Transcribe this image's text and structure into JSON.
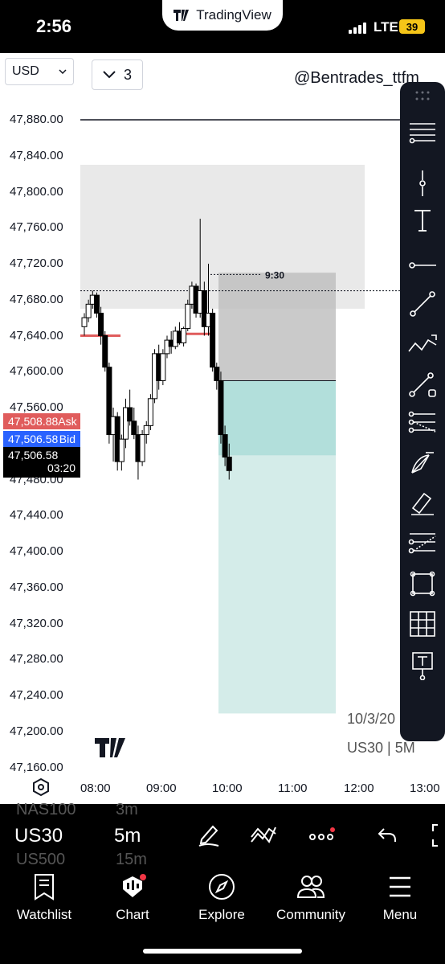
{
  "status_bar": {
    "time": "2:56",
    "app_name": "TradingView",
    "network": "LTE",
    "battery": "39"
  },
  "chart": {
    "currency_select": "USD",
    "interval_multiplier": "3",
    "watermark_handle": "@Bentrades_ttfm",
    "price_labels": [
      "47,880.00",
      "47,840.00",
      "47,800.00",
      "47,760.00",
      "47,720.00",
      "47,680.00",
      "47,640.00",
      "47,600.00",
      "47,560.00",
      "47,480.00",
      "47,440.00",
      "47,400.00",
      "47,360.00",
      "47,320.00",
      "47,280.00",
      "47,240.00",
      "47,200.00",
      "47,160.00"
    ],
    "time_labels": [
      "08:00",
      "09:00",
      "10:00",
      "11:00",
      "12:00",
      "13:00"
    ],
    "ask": {
      "price": "47,508.88",
      "label": "Ask"
    },
    "bid": {
      "price": "47,506.58",
      "label": "Bid"
    },
    "last": {
      "price": "47,506.58",
      "countdown": "03:20"
    },
    "annotation_time": "9:30",
    "date_label": "10/3/20",
    "symbol_label": "US30 | 5M",
    "colors": {
      "ask": "#e05c5c",
      "bid": "#2962ff",
      "profit_zone": "#b2dfdb",
      "loss_zone": "#bdbdbd",
      "supply_zone": "#e9e9e9"
    }
  },
  "chart_data": {
    "type": "candlestick",
    "symbol": "US30",
    "interval": "5M",
    "ylim": [
      47150,
      47900
    ],
    "x_ticks": [
      "08:00",
      "09:00",
      "10:00",
      "11:00",
      "12:00",
      "13:00"
    ],
    "horizontal_line": 47880,
    "supply_zone": [
      47670,
      47830
    ],
    "position": {
      "entry": 47590,
      "stop": 47710,
      "target": 47220,
      "partial": 47507
    },
    "candles": [
      {
        "o": 47650,
        "h": 47665,
        "l": 47640,
        "c": 47660
      },
      {
        "o": 47660,
        "h": 47680,
        "l": 47655,
        "c": 47675
      },
      {
        "o": 47675,
        "h": 47690,
        "l": 47670,
        "c": 47685
      },
      {
        "o": 47685,
        "h": 47688,
        "l": 47660,
        "c": 47665
      },
      {
        "o": 47665,
        "h": 47672,
        "l": 47630,
        "c": 47640
      },
      {
        "o": 47640,
        "h": 47645,
        "l": 47600,
        "c": 47605
      },
      {
        "o": 47605,
        "h": 47610,
        "l": 47520,
        "c": 47530
      },
      {
        "o": 47530,
        "h": 47560,
        "l": 47500,
        "c": 47550
      },
      {
        "o": 47550,
        "h": 47555,
        "l": 47490,
        "c": 47500
      },
      {
        "o": 47500,
        "h": 47530,
        "l": 47490,
        "c": 47525
      },
      {
        "o": 47525,
        "h": 47570,
        "l": 47515,
        "c": 47560
      },
      {
        "o": 47560,
        "h": 47580,
        "l": 47540,
        "c": 47545
      },
      {
        "o": 47545,
        "h": 47560,
        "l": 47525,
        "c": 47530
      },
      {
        "o": 47530,
        "h": 47540,
        "l": 47480,
        "c": 47500
      },
      {
        "o": 47500,
        "h": 47535,
        "l": 47495,
        "c": 47530
      },
      {
        "o": 47530,
        "h": 47545,
        "l": 47520,
        "c": 47540
      },
      {
        "o": 47540,
        "h": 47575,
        "l": 47535,
        "c": 47570
      },
      {
        "o": 47570,
        "h": 47625,
        "l": 47565,
        "c": 47620
      },
      {
        "o": 47620,
        "h": 47630,
        "l": 47580,
        "c": 47590
      },
      {
        "o": 47590,
        "h": 47625,
        "l": 47585,
        "c": 47620
      },
      {
        "o": 47620,
        "h": 47640,
        "l": 47615,
        "c": 47635
      },
      {
        "o": 47635,
        "h": 47645,
        "l": 47620,
        "c": 47628
      },
      {
        "o": 47628,
        "h": 47650,
        "l": 47625,
        "c": 47645
      },
      {
        "o": 47645,
        "h": 47655,
        "l": 47630,
        "c": 47632
      },
      {
        "o": 47632,
        "h": 47650,
        "l": 47628,
        "c": 47648
      },
      {
        "o": 47648,
        "h": 47680,
        "l": 47645,
        "c": 47675
      },
      {
        "o": 47675,
        "h": 47700,
        "l": 47670,
        "c": 47695
      },
      {
        "o": 47695,
        "h": 47698,
        "l": 47660,
        "c": 47665
      },
      {
        "o": 47665,
        "h": 47770,
        "l": 47660,
        "c": 47690
      },
      {
        "o": 47690,
        "h": 47700,
        "l": 47640,
        "c": 47650
      },
      {
        "o": 47650,
        "h": 47720,
        "l": 47640,
        "c": 47665
      },
      {
        "o": 47665,
        "h": 47670,
        "l": 47600,
        "c": 47605
      },
      {
        "o": 47605,
        "h": 47610,
        "l": 47580,
        "c": 47590
      },
      {
        "o": 47590,
        "h": 47600,
        "l": 47520,
        "c": 47530
      },
      {
        "o": 47530,
        "h": 47540,
        "l": 47495,
        "c": 47505
      },
      {
        "o": 47505,
        "h": 47520,
        "l": 47480,
        "c": 47490
      }
    ]
  },
  "symbol_bar": {
    "prev_symbol": "NAS100",
    "prev_interval": "3m",
    "symbol": "US30",
    "interval": "5m",
    "next_symbol": "US500",
    "next_interval": "15m"
  },
  "bottom_nav": [
    {
      "label": "Watchlist",
      "icon": "bookmark-icon"
    },
    {
      "label": "Chart",
      "icon": "chart-icon"
    },
    {
      "label": "Explore",
      "icon": "compass-icon"
    },
    {
      "label": "Community",
      "icon": "people-icon"
    },
    {
      "label": "Menu",
      "icon": "menu-icon"
    }
  ]
}
